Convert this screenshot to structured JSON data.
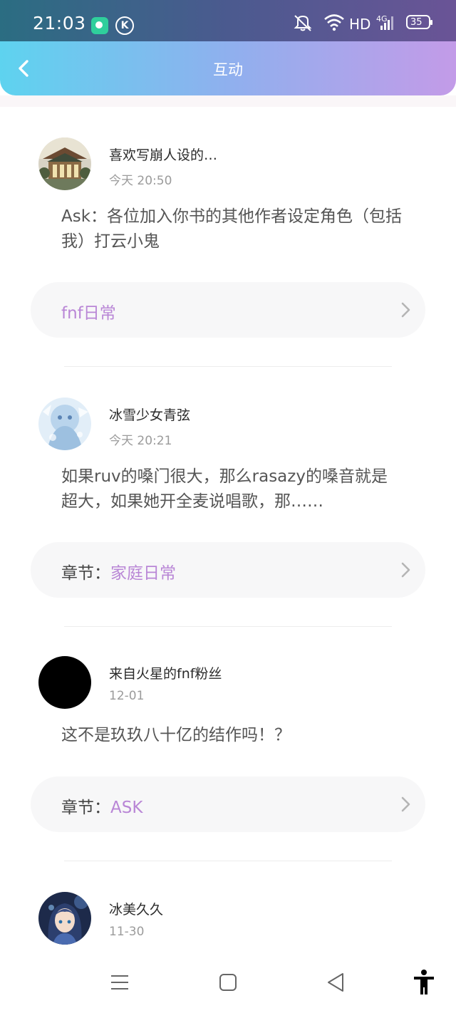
{
  "status_bar": {
    "time": "21:03",
    "network_label": "HD",
    "cell_label": "4G",
    "battery": "35"
  },
  "header": {
    "title": "互动"
  },
  "posts": [
    {
      "user": "喜欢写崩人设的…",
      "date": "今天 20:50",
      "content": "Ask：各位加入你书的其他作者设定角色（包括我）打云小鬼",
      "chapter_prefix": "",
      "chapter_name": "fnf日常"
    },
    {
      "user": "冰雪少女青弦",
      "date": "今天 20:21",
      "content": "如果ruv的嗓门很大，那么rasazy的嗓音就是超大，如果她开全麦说唱歌，那……",
      "chapter_prefix": "章节：",
      "chapter_name": "家庭日常"
    },
    {
      "user": "来自火星的fnf粉丝",
      "date": "12-01",
      "content": "这不是玖玖八十亿的结作吗！？",
      "chapter_prefix": "章节：",
      "chapter_name": "ASK"
    },
    {
      "user": "冰美久久",
      "date": "11-30"
    }
  ],
  "colors": {
    "accent": "#b986d6",
    "header_start": "#5ed3ef",
    "header_end": "#c39be8"
  },
  "icons": {
    "back": "chevron-left-icon",
    "chapter_arrow": "chevron-right-icon",
    "nav_menu": "menu-icon",
    "nav_home": "home-icon",
    "nav_back": "back-triangle-icon",
    "accessibility": "accessibility-icon"
  }
}
